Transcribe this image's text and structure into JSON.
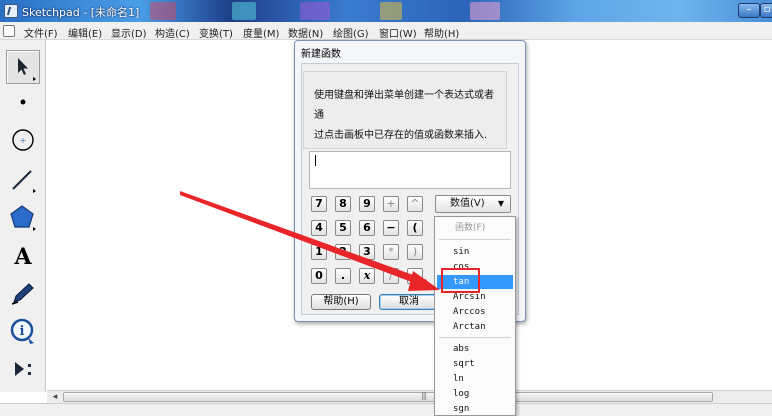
{
  "window": {
    "title": "Sketchpad - [未命名1]",
    "minimize_glyph": "–",
    "restore_glyph": "▫"
  },
  "menubar": {
    "items": [
      "文件(F)",
      "编辑(E)",
      "显示(D)",
      "构造(C)",
      "变换(T)",
      "度量(M)",
      "数据(N)",
      "绘图(G)",
      "窗口(W)",
      "帮助(H)"
    ]
  },
  "toolbox": {
    "tools": [
      "arrow-select-icon",
      "point-icon",
      "compass-circle-icon",
      "straightedge-icon",
      "polygon-icon",
      "text-icon",
      "marker-pen-icon",
      "information-icon",
      "custom-tool-icon"
    ],
    "text_tool_glyph": "A",
    "info_glyph": "i"
  },
  "dialog": {
    "title": "新建函数",
    "description_line1": "使用键盘和弹出菜单创建一个表达式或者通",
    "description_line2": "过点击画板中已存在的值或函数来插入.",
    "expression_value": "",
    "keypad": {
      "row1": [
        "7",
        "8",
        "9",
        "+",
        "^"
      ],
      "row2": [
        "4",
        "5",
        "6",
        "−",
        "("
      ],
      "row3": [
        "1",
        "2",
        "3",
        "*",
        ")"
      ],
      "row4": [
        "0",
        ".",
        "x",
        "/",
        "←"
      ]
    },
    "value_dropdown": "数值(V)",
    "help_button": "帮助(H)",
    "cancel_button": "取消"
  },
  "function_menu": {
    "header": "函数(F)",
    "items_group1": [
      "sin",
      "cos",
      "tan",
      "Arcsin",
      "Arccos",
      "Arctan"
    ],
    "items_group2": [
      "abs",
      "sqrt",
      "ln",
      "log",
      "sgn"
    ],
    "selected": "tan"
  },
  "colors": {
    "accent_selection": "#3399ff",
    "annotation_red": "#e8262a"
  }
}
